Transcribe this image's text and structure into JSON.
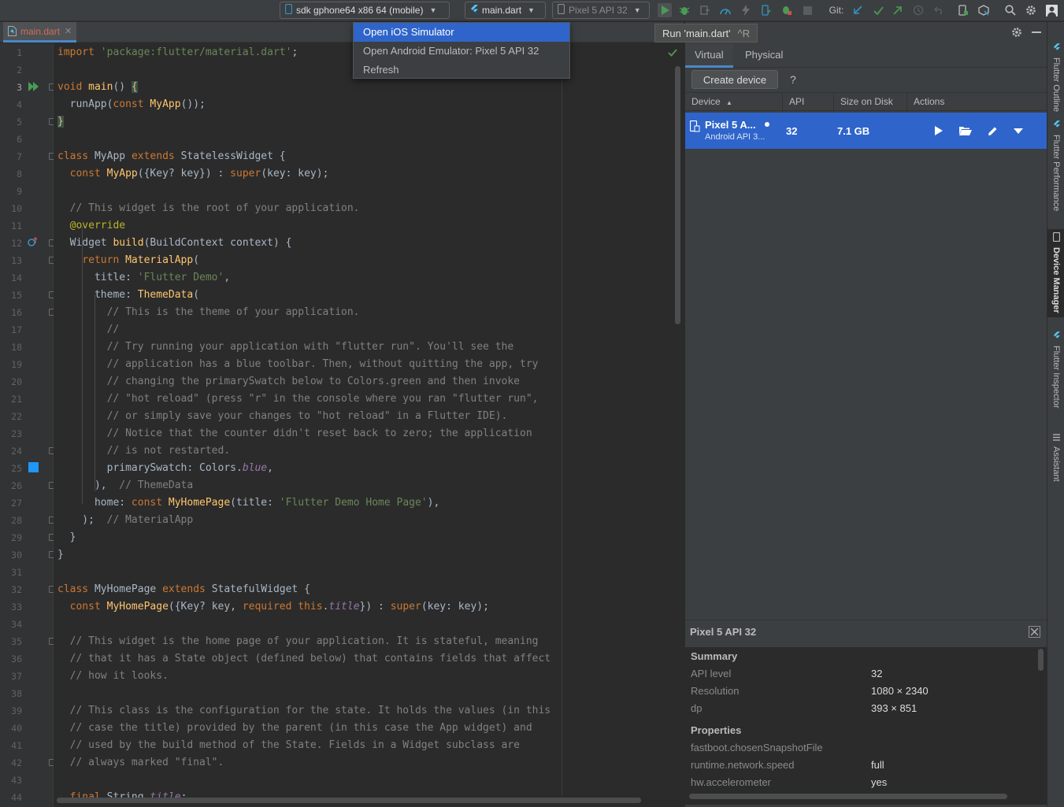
{
  "toolbar": {
    "device_target": "sdk gphone64 x86 64 (mobile)",
    "run_config": "main.dart",
    "avd_selector": "Pixel 5 API 32",
    "git_label": "Git:"
  },
  "popup_menu": {
    "items": [
      {
        "label": "Open iOS Simulator",
        "selected": true
      },
      {
        "label": "Open Android Emulator: Pixel 5 API 32",
        "selected": false
      },
      {
        "label": "Refresh",
        "selected": false
      }
    ]
  },
  "tooltip": {
    "text": "Run 'main.dart'",
    "shortcut": "^R"
  },
  "editor": {
    "tab_name": "main.dart",
    "current_line": 3,
    "lines": [
      [
        [
          "kw",
          "import "
        ],
        [
          "str",
          "'package:flutter/material.dart'"
        ],
        [
          "",
          "; "
        ]
      ],
      [],
      [
        [
          "kw",
          "void "
        ],
        [
          "fn",
          "main"
        ],
        [
          "",
          "() "
        ],
        [
          "br",
          "{"
        ]
      ],
      [
        [
          "",
          "  runApp("
        ],
        [
          "kw",
          "const "
        ],
        [
          "fn",
          "MyApp"
        ],
        [
          "",
          "());"
        ]
      ],
      [
        [
          "br",
          "}"
        ]
      ],
      [],
      [
        [
          "kw",
          "class "
        ],
        [
          "",
          "MyApp "
        ],
        [
          "kw",
          "extends "
        ],
        [
          "",
          "StatelessWidget {"
        ]
      ],
      [
        [
          "",
          "  "
        ],
        [
          "kw",
          "const "
        ],
        [
          "fn",
          "MyApp"
        ],
        [
          "",
          "({Key? key}) : "
        ],
        [
          "kw",
          "super"
        ],
        [
          "",
          "(key: key);"
        ]
      ],
      [],
      [
        [
          "cm",
          "  // This widget is the root of your application."
        ]
      ],
      [
        [
          "an",
          "  @override"
        ]
      ],
      [
        [
          "",
          "  Widget "
        ],
        [
          "fn",
          "build"
        ],
        [
          "",
          "(BuildContext context) {"
        ]
      ],
      [
        [
          "",
          "    "
        ],
        [
          "kw",
          "return "
        ],
        [
          "fn",
          "MaterialApp"
        ],
        [
          "",
          "("
        ]
      ],
      [
        [
          "",
          "      title: "
        ],
        [
          "str",
          "'Flutter Demo'"
        ],
        [
          "",
          ","
        ]
      ],
      [
        [
          "",
          "      theme: "
        ],
        [
          "fn",
          "ThemeData"
        ],
        [
          "",
          "("
        ]
      ],
      [
        [
          "cm",
          "        // This is the theme of your application."
        ]
      ],
      [
        [
          "cm",
          "        //"
        ]
      ],
      [
        [
          "cm",
          "        // Try running your application with \"flutter run\". You'll see the"
        ]
      ],
      [
        [
          "cm",
          "        // application has a blue toolbar. Then, without quitting the app, try"
        ]
      ],
      [
        [
          "cm",
          "        // changing the primarySwatch below to Colors.green and then invoke"
        ]
      ],
      [
        [
          "cm",
          "        // \"hot reload\" (press \"r\" in the console where you ran \"flutter run\","
        ]
      ],
      [
        [
          "cm",
          "        // or simply save your changes to \"hot reload\" in a Flutter IDE)."
        ]
      ],
      [
        [
          "cm",
          "        // Notice that the counter didn't reset back to zero; the application"
        ]
      ],
      [
        [
          "cm",
          "        // is not restarted."
        ]
      ],
      [
        [
          "",
          "        primarySwatch: Colors."
        ],
        [
          "it",
          "blue"
        ],
        [
          "",
          ","
        ]
      ],
      [
        [
          "",
          "      ),  "
        ],
        [
          "cm",
          "// ThemeData"
        ]
      ],
      [
        [
          "",
          "      home: "
        ],
        [
          "kw",
          "const "
        ],
        [
          "fn",
          "MyHomePage"
        ],
        [
          "",
          "(title: "
        ],
        [
          "str",
          "'Flutter Demo Home Page'"
        ],
        [
          "",
          "),"
        ]
      ],
      [
        [
          "",
          "    );  "
        ],
        [
          "cm",
          "// MaterialApp"
        ]
      ],
      [
        [
          "",
          "  }"
        ]
      ],
      [
        [
          "",
          "}"
        ]
      ],
      [],
      [
        [
          "kw",
          "class "
        ],
        [
          "",
          "MyHomePage "
        ],
        [
          "kw",
          "extends "
        ],
        [
          "",
          "StatefulWidget {"
        ]
      ],
      [
        [
          "",
          "  "
        ],
        [
          "kw",
          "const "
        ],
        [
          "fn",
          "MyHomePage"
        ],
        [
          "",
          "({Key? key, "
        ],
        [
          "kw",
          "required this"
        ],
        [
          "",
          "."
        ],
        [
          "it",
          "title"
        ],
        [
          "",
          "}) : "
        ],
        [
          "kw",
          "super"
        ],
        [
          "",
          "(key: key);"
        ]
      ],
      [],
      [
        [
          "cm",
          "  // This widget is the home page of your application. It is stateful, meaning"
        ]
      ],
      [
        [
          "cm",
          "  // that it has a State object (defined below) that contains fields that affect"
        ]
      ],
      [
        [
          "cm",
          "  // how it looks."
        ]
      ],
      [],
      [
        [
          "cm",
          "  // This class is the configuration for the state. It holds the values (in this"
        ]
      ],
      [
        [
          "cm",
          "  // case the title) provided by the parent (in this case the App widget) and"
        ]
      ],
      [
        [
          "cm",
          "  // used by the build method of the State. Fields in a Widget subclass are"
        ]
      ],
      [
        [
          "cm",
          "  // always marked \"final\"."
        ]
      ],
      [],
      [
        [
          "kw",
          "  final "
        ],
        [
          "",
          "String "
        ],
        [
          "it",
          "title"
        ],
        [
          "",
          ";"
        ]
      ]
    ]
  },
  "device_manager": {
    "tabs": [
      "Virtual",
      "Physical"
    ],
    "active_tab": "Virtual",
    "create_button": "Create device",
    "help": "?",
    "columns": [
      "Device",
      "API",
      "Size on Disk",
      "Actions"
    ],
    "devices": [
      {
        "name": "Pixel 5 A...",
        "subtitle": "Android API 3...",
        "api": "32",
        "size": "7.1 GB"
      }
    ],
    "details": {
      "title": "Pixel 5 API 32",
      "summary_heading": "Summary",
      "summary": [
        {
          "key": "API level",
          "value": "32"
        },
        {
          "key": "Resolution",
          "value": "1080 × 2340"
        },
        {
          "key": "dp",
          "value": "393 × 851"
        }
      ],
      "properties_heading": "Properties",
      "properties": [
        {
          "key": "fastboot.chosenSnapshotFile",
          "value": ""
        },
        {
          "key": "runtime.network.speed",
          "value": "full"
        },
        {
          "key": "hw.accelerometer",
          "value": "yes"
        }
      ]
    }
  },
  "side_stripe": {
    "items": [
      {
        "label": "Flutter Outline",
        "active": false
      },
      {
        "label": "Flutter Performance",
        "active": false
      },
      {
        "label": "Device Manager",
        "active": true
      },
      {
        "label": "Flutter Inspector",
        "active": false
      },
      {
        "label": "Assistant",
        "active": false
      }
    ]
  },
  "colors": {
    "accent": "#4a88c7",
    "selection": "#2f65ca",
    "run_green": "#499c54"
  }
}
